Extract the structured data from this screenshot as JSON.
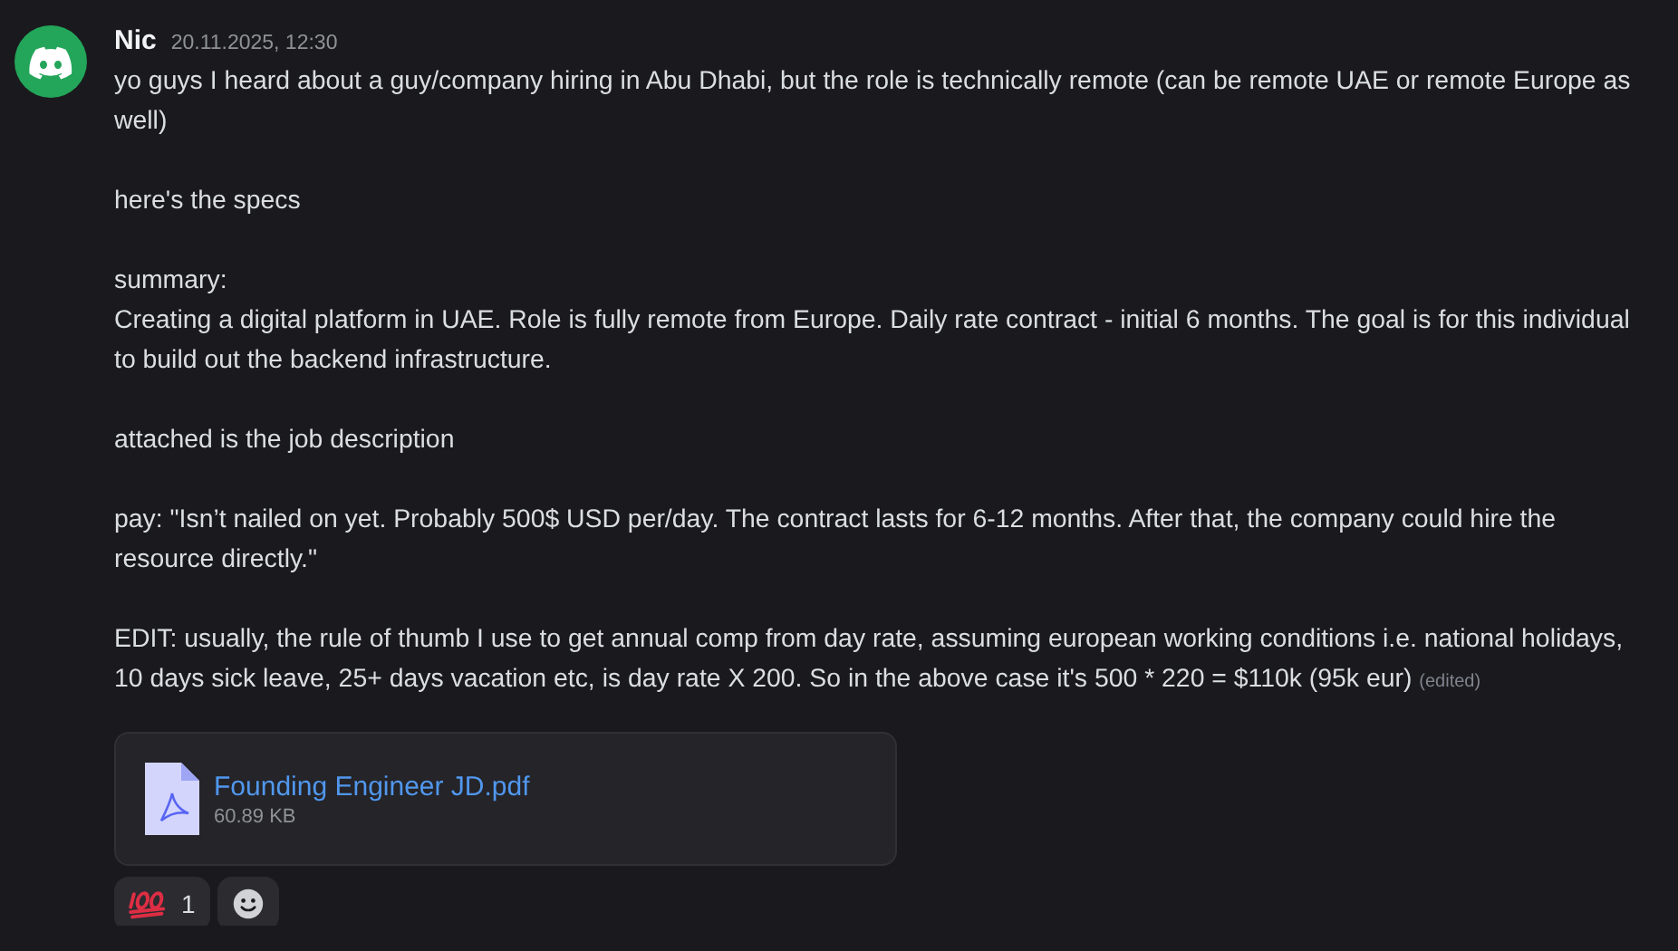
{
  "message": {
    "author": "Nic",
    "timestamp": "20.11.2025, 12:30",
    "paragraphs": [
      "yo guys I heard about a guy/company hiring in Abu Dhabi, but the role is technically remote (can be remote UAE or remote Europe as well)",
      "here's the specs",
      "summary:\nCreating a digital platform in UAE. Role is fully remote from Europe. Daily rate contract - initial 6 months. The goal is for this individual to build out the backend infrastructure.",
      "attached is the job description",
      "pay: \"Isn’t nailed on yet. Probably 500$ USD per/day. The contract lasts for 6-12 months. After that, the company could hire the resource directly.\"",
      "EDIT: usually, the rule of thumb I use to get annual comp from day rate, assuming european working conditions i.e. national holidays, 10 days sick leave, 25+ days vacation etc, is day rate X 200. So in the above case it's 500 * 220 = $110k (95k eur)"
    ],
    "edited_label": "(edited)",
    "attachment": {
      "name": "Founding Engineer JD.pdf",
      "size": "60.89 KB"
    },
    "reactions": [
      {
        "count": "1",
        "selected": false
      }
    ]
  }
}
